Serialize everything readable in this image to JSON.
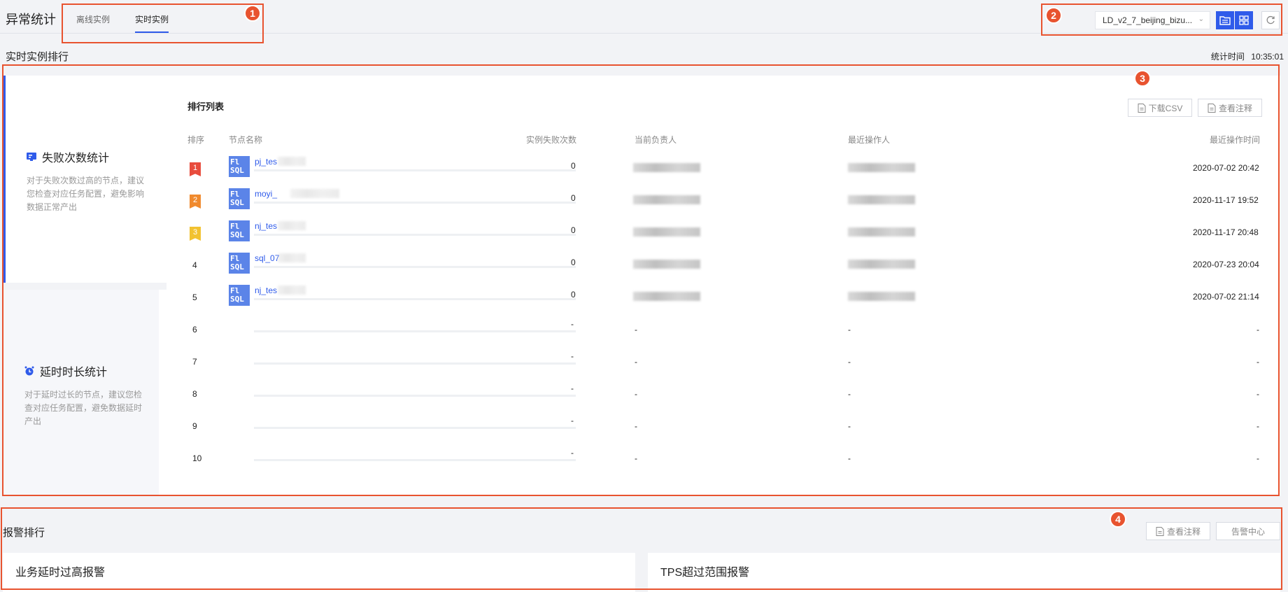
{
  "header": {
    "title": "异常统计",
    "tabs": [
      {
        "label": "离线实例",
        "active": false
      },
      {
        "label": "实时实例",
        "active": true
      }
    ],
    "project_select": "LD_v2_7_beijing_bizu...",
    "refresh_icon": "refresh-icon"
  },
  "badges": [
    "1",
    "2",
    "3",
    "4"
  ],
  "section": {
    "title": "实时实例排行",
    "stat_time_label": "统计时间",
    "stat_time_value": "10:35:01"
  },
  "side": {
    "fail": {
      "title": "失败次数统计",
      "desc": "对于失败次数过高的节点，建议您检查对应任务配置，避免影响数据正常产出"
    },
    "delay": {
      "title": "延时时长统计",
      "desc": "对于延时过长的节点，建议您检查对应任务配置，避免数据延时产出"
    }
  },
  "list": {
    "title": "排行列表",
    "download_label": "下载CSV",
    "notes_label": "查看注释",
    "columns": [
      "排序",
      "节点名称",
      "实例失败次数",
      "当前负责人",
      "最近操作人",
      "最近操作时间"
    ],
    "rows": [
      {
        "rank": "1",
        "name": "pj_tes",
        "fails": "0",
        "owner": "",
        "operator": "",
        "time": "2020-07-02 20:42"
      },
      {
        "rank": "2",
        "name": "moyi_",
        "fails": "0",
        "owner": "",
        "operator": "",
        "time": "2020-11-17 19:52"
      },
      {
        "rank": "3",
        "name": "nj_tes",
        "fails": "0",
        "owner": "",
        "operator": "",
        "time": "2020-11-17 20:48"
      },
      {
        "rank": "4",
        "name": "sql_07",
        "fails": "0",
        "owner": "",
        "operator": "",
        "time": "2020-07-23 20:04"
      },
      {
        "rank": "5",
        "name": "nj_tes",
        "fails": "0",
        "owner": "",
        "operator": "",
        "time": "2020-07-02 21:14"
      },
      {
        "rank": "6",
        "name": "",
        "fails": "-",
        "owner": "-",
        "operator": "-",
        "time": "-"
      },
      {
        "rank": "7",
        "name": "",
        "fails": "-",
        "owner": "-",
        "operator": "-",
        "time": "-"
      },
      {
        "rank": "8",
        "name": "",
        "fails": "-",
        "owner": "-",
        "operator": "-",
        "time": "-"
      },
      {
        "rank": "9",
        "name": "",
        "fails": "-",
        "owner": "-",
        "operator": "-",
        "time": "-"
      },
      {
        "rank": "10",
        "name": "",
        "fails": "-",
        "owner": "-",
        "operator": "-",
        "time": "-"
      }
    ],
    "node_icon_text": "Fl SQL"
  },
  "alarm": {
    "title": "报警排行",
    "notes_label": "查看注释",
    "center_label": "告警中心",
    "cards": [
      {
        "title": "业务延时过高报警"
      },
      {
        "title": "TPS超过范围报警"
      }
    ]
  },
  "colors": {
    "accent": "#2f5bea",
    "annotation": "#e8532f",
    "rank1": "#e84c3d",
    "rank2": "#f08a2e",
    "rank3": "#f2c230"
  }
}
